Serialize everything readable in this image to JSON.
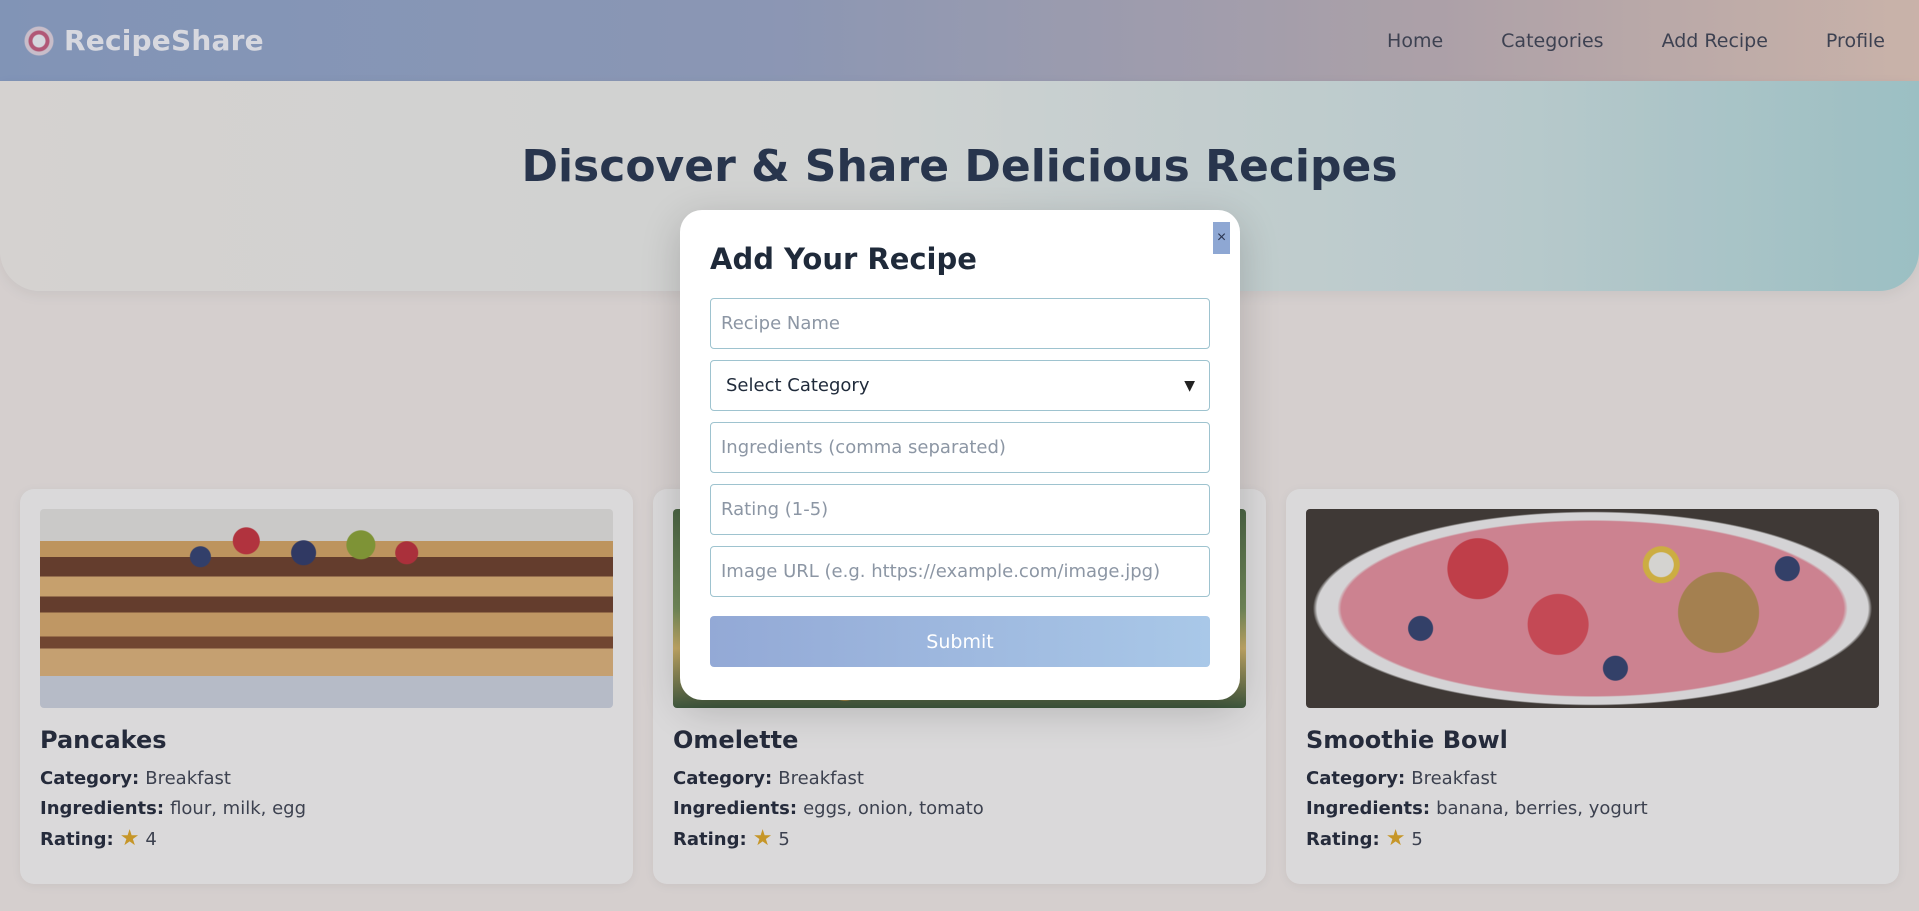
{
  "nav": {
    "brand": "RecipeShare",
    "links": [
      "Home",
      "Categories",
      "Add Recipe",
      "Profile"
    ]
  },
  "hero": {
    "title": "Discover & Share Delicious Recipes",
    "subtitle": ""
  },
  "cards": [
    {
      "title": "Pancakes",
      "category_label": "Category:",
      "category": "Breakfast",
      "ingredients_label": "Ingredients:",
      "ingredients": "flour, milk, egg",
      "rating_label": "Rating:",
      "rating": "4"
    },
    {
      "title": "Omelette",
      "category_label": "Category:",
      "category": "Breakfast",
      "ingredients_label": "Ingredients:",
      "ingredients": "eggs, onion, tomato",
      "rating_label": "Rating:",
      "rating": "5"
    },
    {
      "title": "Smoothie Bowl",
      "category_label": "Category:",
      "category": "Breakfast",
      "ingredients_label": "Ingredients:",
      "ingredients": "banana, berries, yogurt",
      "rating_label": "Rating:",
      "rating": "5"
    }
  ],
  "modal": {
    "title": "Add Your Recipe",
    "close": "×",
    "name_placeholder": "Recipe Name",
    "category_selected": "Select Category",
    "ingredients_placeholder": "Ingredients (comma separated)",
    "rating_placeholder": "Rating (1-5)",
    "image_placeholder": "Image URL (e.g. https://example.com/image.jpg)",
    "submit": "Submit"
  }
}
